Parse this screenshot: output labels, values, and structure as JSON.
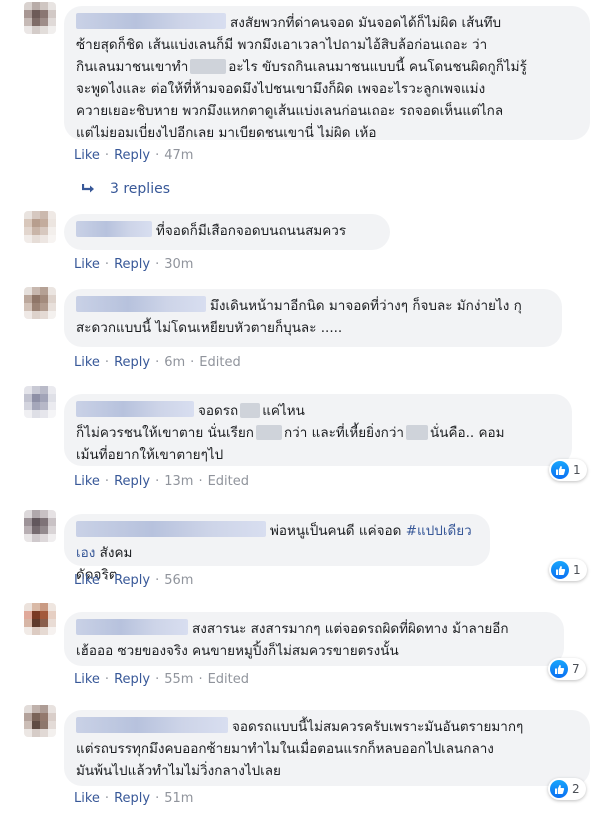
{
  "labels": {
    "like": "Like",
    "reply": "Reply",
    "edited": "Edited"
  },
  "thread": {
    "replies_label": "3 replies"
  },
  "colors": {
    "link": "#385898",
    "bubble": "#f2f3f5",
    "muted": "#90949c",
    "like_blue": "#0b6ff2"
  },
  "comments": [
    {
      "lines": [
        "สงสัยพวกที่ด่าคนจอด มันจอดได้ก็ไม่ผิด เส้นทึบ",
        "ซ้ายสุดก็ชิด เส้นแบ่งเลนก็มี พวกมึงเอาเวลาไปถามไอ้สิบล้อก่อนเถอะ ว่า",
        "กินเลนมาชนเขาทำ",
        "อะไร ขับรถกินเลนมาชนแบบนี้ คนโดนชนผิดกูก็ไม่รู้",
        "จะพูดไงและ ต่อให้ที่ห้ามจอดมึงไปชนเขามึงก็ผิด เพจอะไรวะลูกเพจแม่ง",
        "ควายเยอะชิบหาย พวกมึงแหกตาดูเส้นแบ่งเลนก่อนเถอะ รถจอดเห็นแต่ไกล",
        "แต่ไม่ยอมเบี่ยงไปอีกเลย มาเบียดชนเขานี่ ไม่ผิด เห้อ"
      ],
      "time": "47m",
      "edited": false,
      "reactions": null
    },
    {
      "lines": [
        "ที่จอดก็มีเสือกจอดบนถนนสมควร"
      ],
      "time": "30m",
      "edited": false,
      "reactions": null
    },
    {
      "lines": [
        "มึงเดินหน้ามาอีกนิด มาจอดที่ว่างๆ ก็จบละ มักง่ายไง กุ",
        "สะดวกแบบนี้ ไม่โดนเหยียบหัวตายก็บุนละ ....."
      ],
      "time": "6m",
      "edited": true,
      "reactions": null
    },
    {
      "lines": [
        "จอดรถ",
        "แค่ไหน",
        "ก็ไม่ควรชนให้เขาตาย นั่นเรียก",
        "กว่า และที่เหี้ยยิ่งกว่า",
        "นั่นคือ.. คอม",
        "เม้นที่อยากให้เขาตายๆไป"
      ],
      "time": "13m",
      "edited": true,
      "reactions": "1"
    },
    {
      "lines": [
        "พ่อหนูเป็นคนดี แค่จอด",
        "#แปปเดียวเอง",
        "สังคม",
        "ดัดจริต"
      ],
      "time": "56m",
      "edited": false,
      "reactions": "1"
    },
    {
      "lines": [
        "สงสารนะ สงสารมากๆ แต่จอดรถผิดที่ผิดทาง ม้าลายอีก",
        "เฮ้อออ ซวยของจริง คนขายหมูปิ้งก็ไม่สมควรขายตรงนั้น"
      ],
      "time": "55m",
      "edited": true,
      "reactions": "7"
    },
    {
      "lines": [
        "จอดรถแบบนี้ไม่สมควรครับเพราะมันอันตรายมากๆ",
        "แต่รถบรรทุกมึงคบออกซ้ายมาทำไมในเมื่อตอนแรกก็หลบออกไปเลนกลาง",
        "มันพ้นไปแล้วทำไมไม่วิ่งกลางไปเลย"
      ],
      "time": "51m",
      "edited": false,
      "reactions": "2"
    }
  ]
}
